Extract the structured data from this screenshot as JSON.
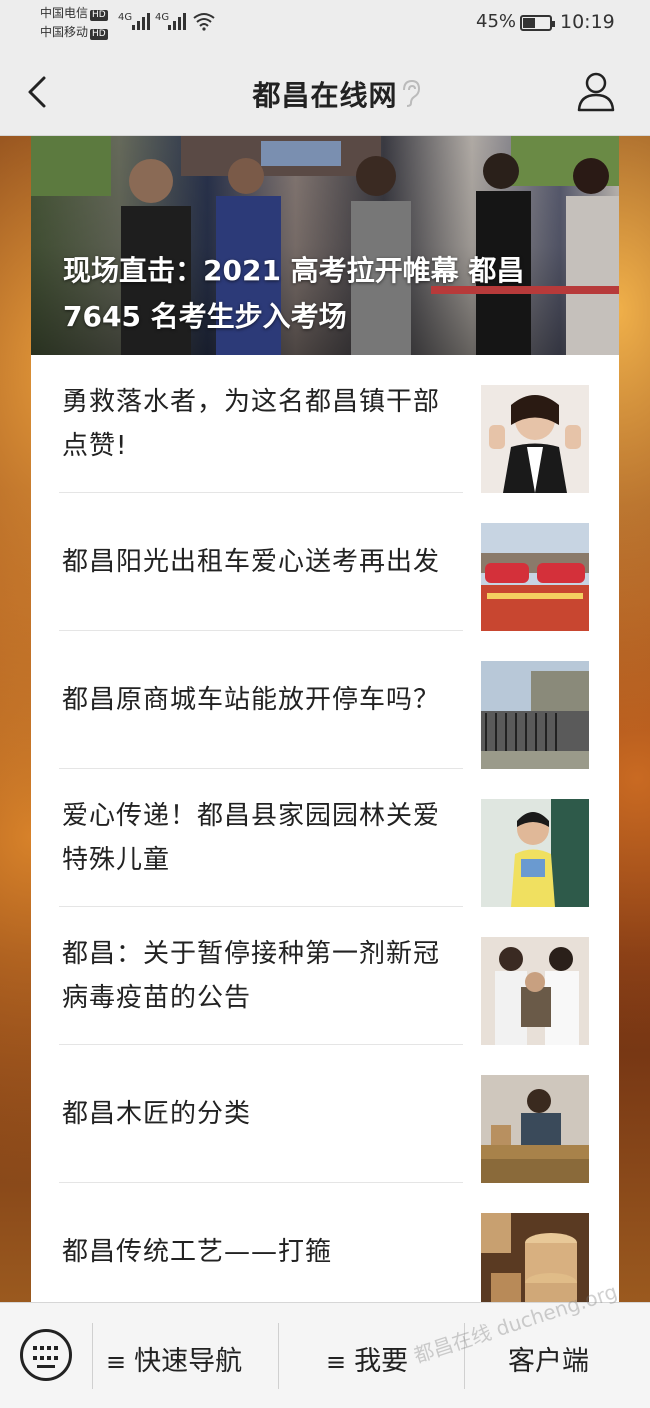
{
  "status": {
    "carrier1": "中国电信",
    "carrier2": "中国移动",
    "hd": "HD",
    "net1": "4G",
    "net2": "4G",
    "battery": "45%",
    "time": "10:19"
  },
  "nav": {
    "title": "都昌在线网"
  },
  "hero": {
    "title": "现场直击：2021 高考拉开帷幕 都昌 7645 名考生步入考场"
  },
  "articles": [
    {
      "title": "勇救落水者，为这名都昌镇干部点赞!",
      "thumb": "person-thumbs-up-image"
    },
    {
      "title": "都昌阳光出租车爱心送考再出发",
      "thumb": "taxi-fleet-image"
    },
    {
      "title": "都昌原商城车站能放开停车吗？",
      "thumb": "station-gate-image"
    },
    {
      "title": "爱心传递！都昌县家园园林关爱特殊儿童",
      "thumb": "child-image"
    },
    {
      "title": "都昌：关于暂停接种第一剂新冠病毒疫苗的公告",
      "thumb": "vaccination-image"
    },
    {
      "title": "都昌木匠的分类",
      "thumb": "carpenter-image"
    },
    {
      "title": "都昌传统工艺——打箍",
      "thumb": "wooden-barrel-image"
    }
  ],
  "bottom": {
    "nav_label": "快速导航",
    "want_label": "我要",
    "client_label": "客户端",
    "menu_glyph": "≡",
    "watermark": "都昌在线 ducheng.org"
  },
  "colors": {
    "bar": "#ededed",
    "card": "#ffffff",
    "text": "#222222"
  }
}
